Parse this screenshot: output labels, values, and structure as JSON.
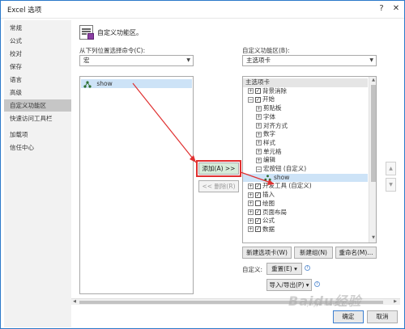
{
  "window": {
    "title": "Excel 选项",
    "help_label": "?",
    "close_label": "✕"
  },
  "nav": {
    "items": [
      "常规",
      "公式",
      "校对",
      "保存",
      "语言",
      "高级",
      "自定义功能区",
      "快速访问工具栏",
      "加载项",
      "信任中心"
    ],
    "active_index": 6
  },
  "header": {
    "title": "自定义功能区。"
  },
  "left_panel": {
    "label": "从下列位置选择命令(C):",
    "dropdown_value": "宏",
    "items": [
      {
        "label": "show",
        "icon": "macro-icon"
      }
    ]
  },
  "right_panel": {
    "label": "自定义功能区(B):",
    "dropdown_value": "主选项卡",
    "tree": [
      {
        "label": "主选项卡",
        "level": 0,
        "expander": "",
        "checkbox": "",
        "highlighted": true
      },
      {
        "label": "背景消除",
        "level": 1,
        "expander": "+",
        "checkbox": "✓"
      },
      {
        "label": "开始",
        "level": 1,
        "expander": "−",
        "checkbox": "✓"
      },
      {
        "label": "剪贴板",
        "level": 2,
        "expander": "+",
        "checkbox": ""
      },
      {
        "label": "字体",
        "level": 2,
        "expander": "+",
        "checkbox": ""
      },
      {
        "label": "对齐方式",
        "level": 2,
        "expander": "+",
        "checkbox": ""
      },
      {
        "label": "数字",
        "level": 2,
        "expander": "+",
        "checkbox": ""
      },
      {
        "label": "样式",
        "level": 2,
        "expander": "+",
        "checkbox": ""
      },
      {
        "label": "单元格",
        "level": 2,
        "expander": "+",
        "checkbox": ""
      },
      {
        "label": "编辑",
        "level": 2,
        "expander": "+",
        "checkbox": ""
      },
      {
        "label": "宏按钮 (自定义)",
        "level": 2,
        "expander": "−",
        "checkbox": ""
      },
      {
        "label": "show",
        "level": 3,
        "expander": "",
        "checkbox": "",
        "icon": "macro-icon",
        "selected": true
      },
      {
        "label": "开发工具 (自定义)",
        "level": 1,
        "expander": "+",
        "checkbox": "✓"
      },
      {
        "label": "插入",
        "level": 1,
        "expander": "+",
        "checkbox": "✓"
      },
      {
        "label": "绘图",
        "level": 1,
        "expander": "+",
        "checkbox": ""
      },
      {
        "label": "页面布局",
        "level": 1,
        "expander": "+",
        "checkbox": "✓"
      },
      {
        "label": "公式",
        "level": 1,
        "expander": "+",
        "checkbox": "✓"
      },
      {
        "label": "数据",
        "level": 1,
        "expander": "+",
        "checkbox": "✓"
      }
    ]
  },
  "middle_buttons": {
    "add_label": "添加(A) >>",
    "remove_label": "<< 删除(R)"
  },
  "bottom_controls": {
    "new_tab_label": "新建选项卡(W)",
    "new_group_label": "新建组(N)",
    "rename_label": "重命名(M)...",
    "customize_label": "自定义:",
    "reset_label": "重置(E) ▾",
    "import_export_label": "导入/导出(P) ▾"
  },
  "footer": {
    "ok_label": "确定",
    "cancel_label": "取消"
  },
  "watermark": {
    "text": "Baidu经验",
    "sub": "jingyan.baidu.com"
  },
  "colors": {
    "accent": "#2b79c9",
    "highlight_frame": "#e03030",
    "arrow": "#e03030",
    "selected_row": "#cde3f7"
  }
}
